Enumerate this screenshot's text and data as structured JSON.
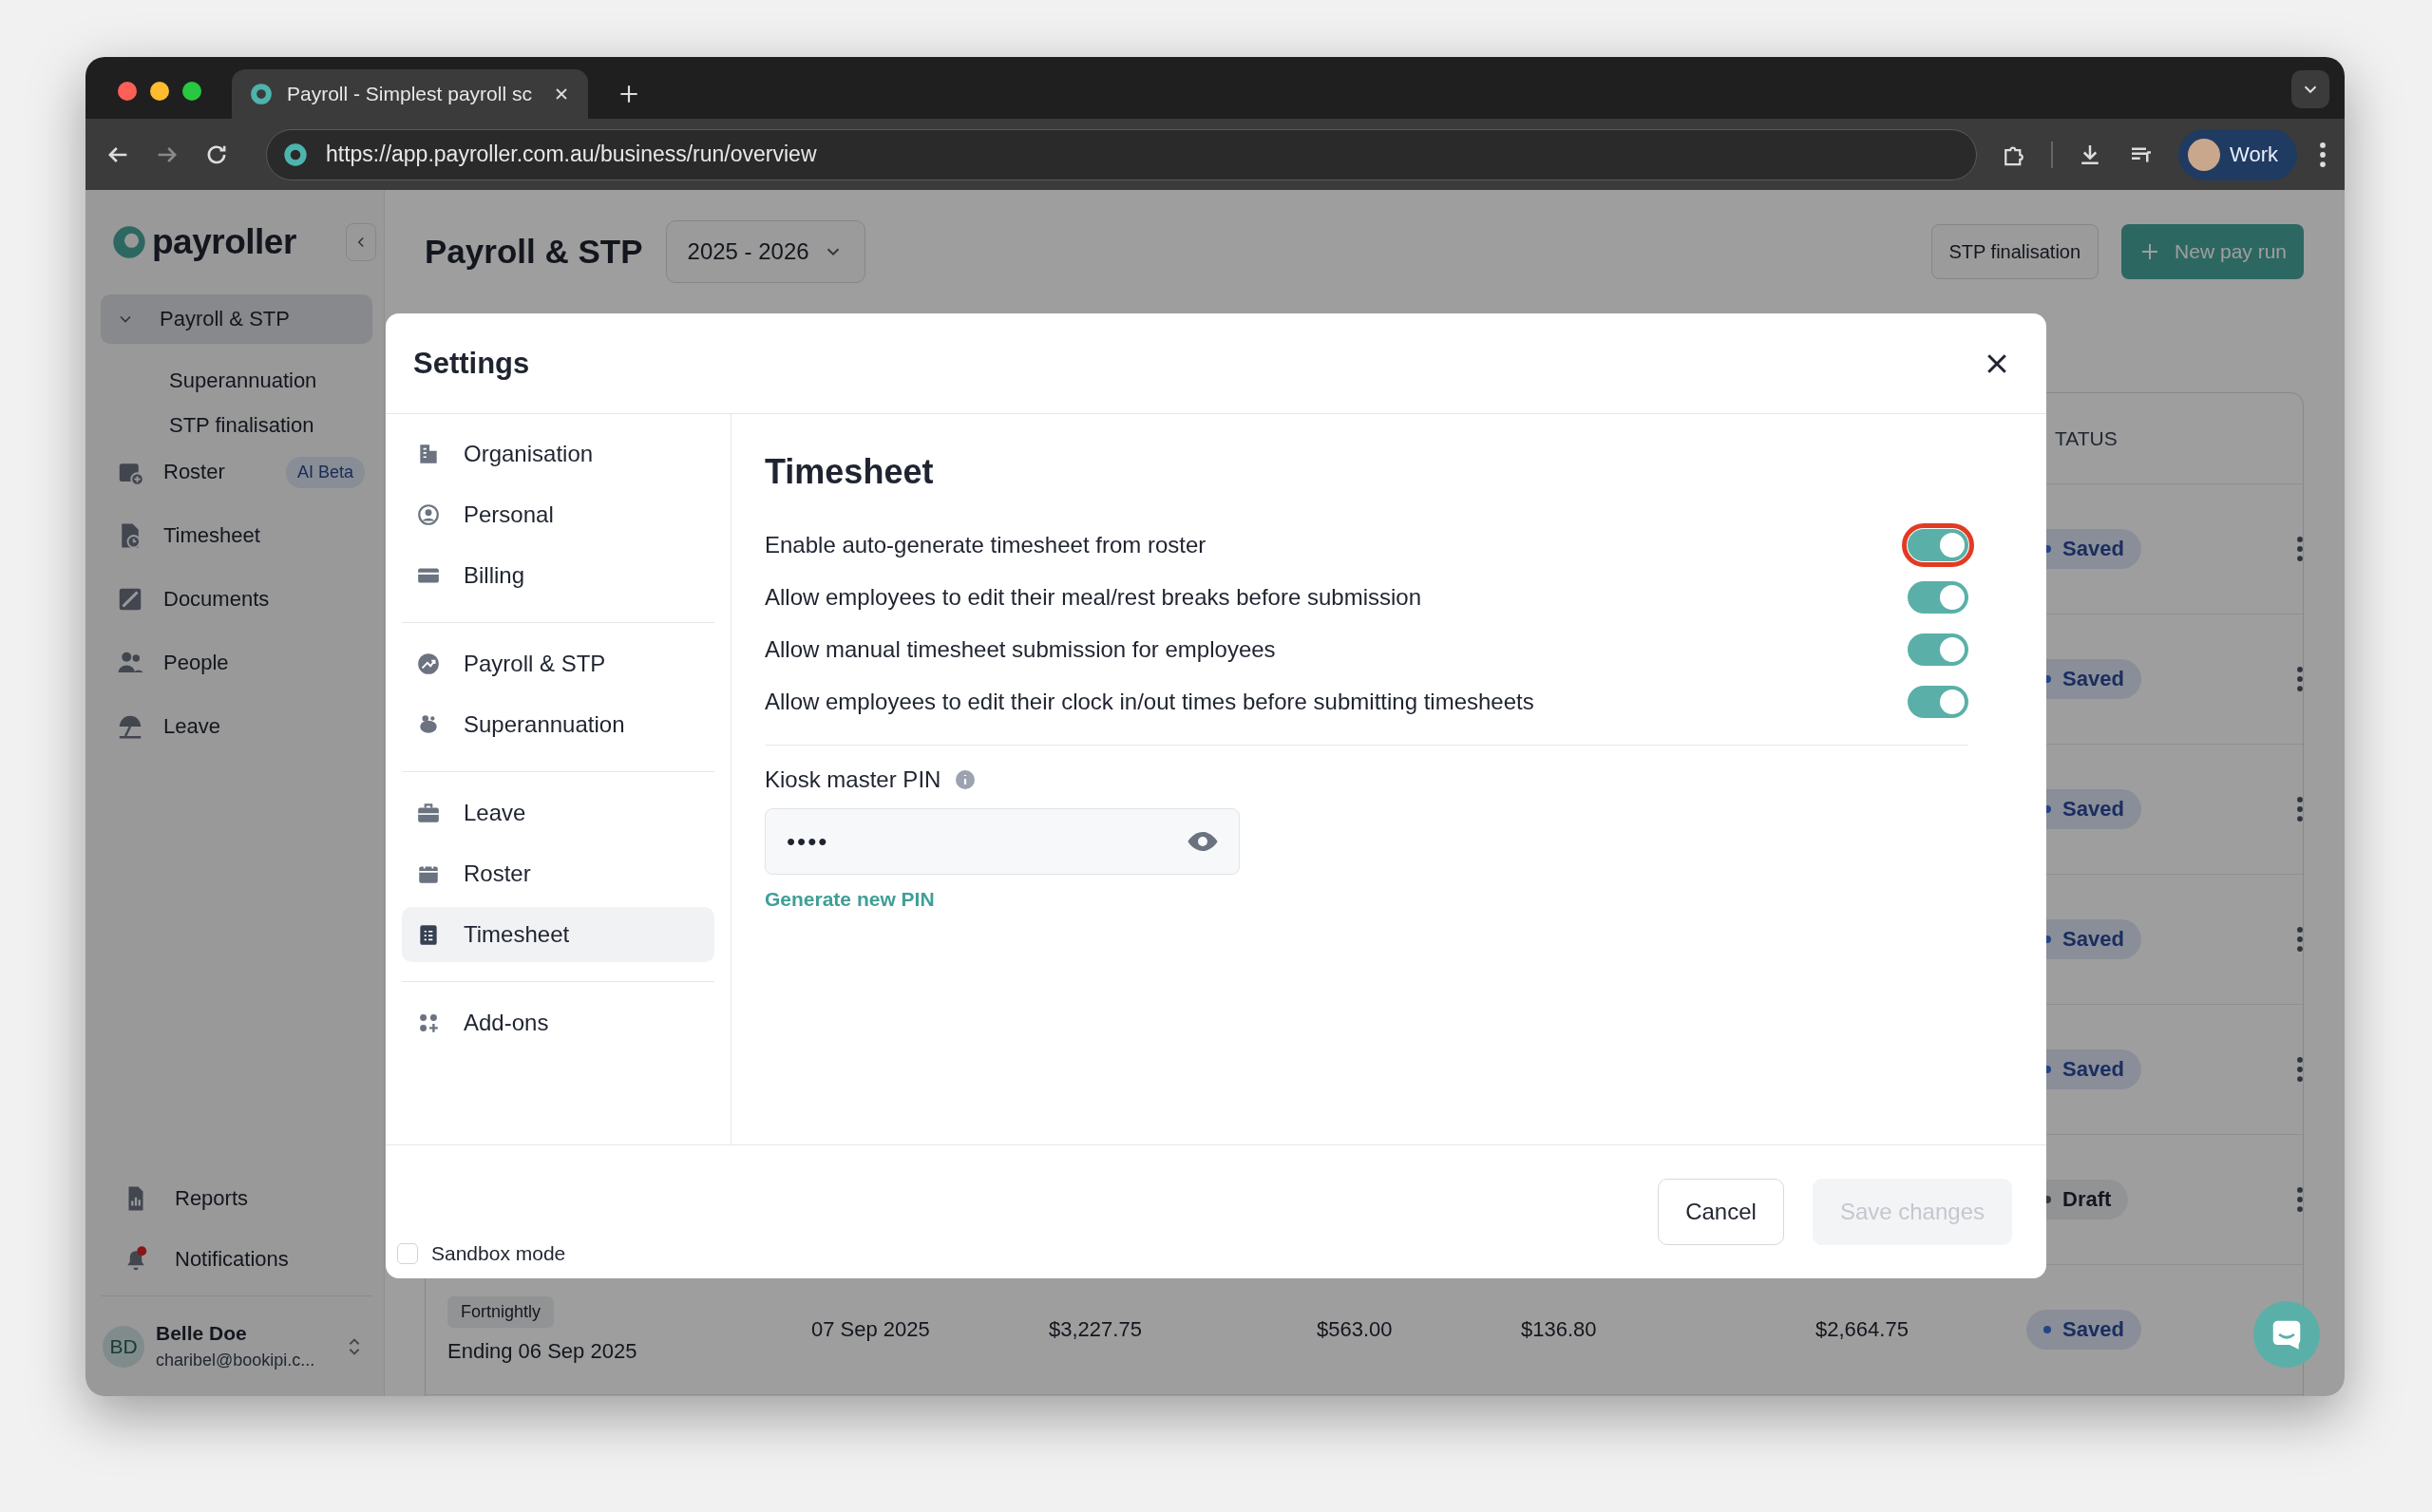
{
  "browser": {
    "tab_title": "Payroll - Simplest payroll sc",
    "url": "https://app.payroller.com.au/business/run/overview",
    "profile": "Work"
  },
  "sidebar": {
    "logo": "payroller",
    "items": [
      {
        "label": "Payroll & STP",
        "kind": "group",
        "expanded": true,
        "selected": true,
        "children": [
          {
            "label": "Superannuation",
            "selected": false
          },
          {
            "label": "STP finalisation",
            "selected": false
          }
        ]
      },
      {
        "label": "Roster",
        "kind": "link",
        "selected": false,
        "badge": "AI Beta"
      },
      {
        "label": "Timesheet",
        "kind": "link",
        "selected": false
      },
      {
        "label": "Documents",
        "kind": "link",
        "selected": false
      },
      {
        "label": "People",
        "kind": "link",
        "selected": false
      },
      {
        "label": "Leave",
        "kind": "link",
        "selected": false
      }
    ],
    "bottom_items": [
      {
        "label": "Reports",
        "unread": false
      },
      {
        "label": "Notifications",
        "unread": true
      }
    ],
    "user": {
      "initials": "BD",
      "name": "Belle Doe",
      "email": "charibel@bookipi.c..."
    }
  },
  "page": {
    "title": "Payroll & STP",
    "year": "2025 - 2026",
    "buttons": [
      {
        "label": "STP finalisation",
        "kind": "secondary"
      },
      {
        "label": "New pay run",
        "kind": "primary"
      }
    ]
  },
  "table": {
    "status_header": "TATUS",
    "rows": [
      {
        "status": "Saved",
        "kind": "saved"
      },
      {
        "status": "Saved",
        "kind": "saved"
      },
      {
        "status": "Saved",
        "kind": "saved"
      },
      {
        "status": "Saved",
        "kind": "saved"
      },
      {
        "status": "Saved",
        "kind": "saved"
      },
      {
        "status": "Draft",
        "kind": "draft"
      },
      {
        "status": "Saved",
        "kind": "saved",
        "frequency": "Fortnightly",
        "period": "Ending 06 Sep 2025",
        "cells": [
          "07 Sep 2025",
          "$3,227.75",
          "$563.00",
          "$136.80",
          "$2,664.75"
        ]
      }
    ]
  },
  "settings_modal": {
    "title": "Settings",
    "nav_groups": [
      {
        "items": [
          {
            "label": "Organisation",
            "selected": false
          },
          {
            "label": "Personal",
            "selected": false
          },
          {
            "label": "Billing",
            "selected": false
          }
        ]
      },
      {
        "items": [
          {
            "label": "Payroll & STP",
            "selected": false
          },
          {
            "label": "Superannuation",
            "selected": false
          }
        ]
      },
      {
        "items": [
          {
            "label": "Leave",
            "selected": false
          },
          {
            "label": "Roster",
            "selected": false
          },
          {
            "label": "Timesheet",
            "selected": true
          }
        ]
      },
      {
        "items": [
          {
            "label": "Add-ons",
            "selected": false
          }
        ]
      }
    ],
    "section_title": "Timesheet",
    "toggles": [
      {
        "label": "Enable auto-generate timesheet from roster",
        "on": true,
        "highlighted": true
      },
      {
        "label": "Allow employees to edit their meal/rest breaks before submission",
        "on": true,
        "highlighted": false
      },
      {
        "label": "Allow manual timesheet submission for employees",
        "on": true,
        "highlighted": false
      },
      {
        "label": "Allow employees to edit their clock in/out times before submitting timesheets",
        "on": true,
        "highlighted": false
      }
    ],
    "pin": {
      "label": "Kiosk master PIN",
      "value": "••••",
      "link": "Generate new PIN"
    },
    "sandbox": {
      "label": "Sandbox mode",
      "checked": false
    },
    "buttons": [
      {
        "label": "Cancel",
        "disabled": false
      },
      {
        "label": "Save changes",
        "disabled": true
      }
    ]
  }
}
